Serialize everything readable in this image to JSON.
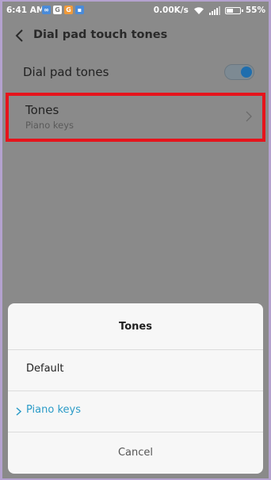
{
  "status_bar": {
    "time": "6:41 AM",
    "notification_icons": [
      "infinity-icon",
      "g-icon",
      "g-orange-icon",
      "file-icon"
    ],
    "notification_glyphs": [
      "∞",
      "G",
      "G",
      "▪"
    ],
    "net_speed": "0.00K/s",
    "battery": "55%",
    "battery_level": 0.55
  },
  "app_bar": {
    "title": "Dial pad touch tones"
  },
  "settings": {
    "dial_pad_tones": {
      "label": "Dial pad tones",
      "enabled": true
    },
    "tones": {
      "title": "Tones",
      "value": "Piano keys",
      "highlight_color": "#e6141c"
    }
  },
  "dialog": {
    "title": "Tones",
    "options": [
      {
        "label": "Default",
        "selected": false
      },
      {
        "label": "Piano keys",
        "selected": true
      }
    ],
    "cancel_label": "Cancel",
    "accent_color": "#2b9bc7"
  }
}
